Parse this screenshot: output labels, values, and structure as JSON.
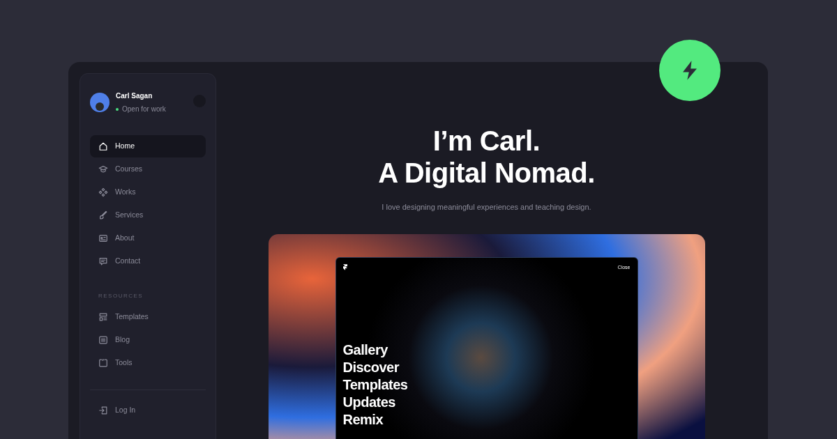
{
  "profile": {
    "name": "Carl Sagan",
    "status": "Open for work"
  },
  "nav": [
    {
      "label": "Home",
      "selected": true
    },
    {
      "label": "Courses",
      "selected": false
    },
    {
      "label": "Works",
      "selected": false
    },
    {
      "label": "Services",
      "selected": false
    },
    {
      "label": "About",
      "selected": false
    },
    {
      "label": "Contact",
      "selected": false
    }
  ],
  "resources": {
    "heading": "RESOURCES",
    "items": [
      {
        "label": "Templates",
        "selected": false
      },
      {
        "label": "Blog",
        "selected": false
      },
      {
        "label": "Tools",
        "selected": false
      }
    ]
  },
  "login": {
    "label": "Log In"
  },
  "hero": {
    "title_lines": [
      "I’m Carl.",
      "A Digital Nomad."
    ],
    "subtitle": "I love designing meaningful experiences and teaching design."
  },
  "preview": {
    "close": "Close",
    "menu": [
      "Gallery",
      "Discover",
      "Templates",
      "Updates",
      "Remix"
    ]
  }
}
